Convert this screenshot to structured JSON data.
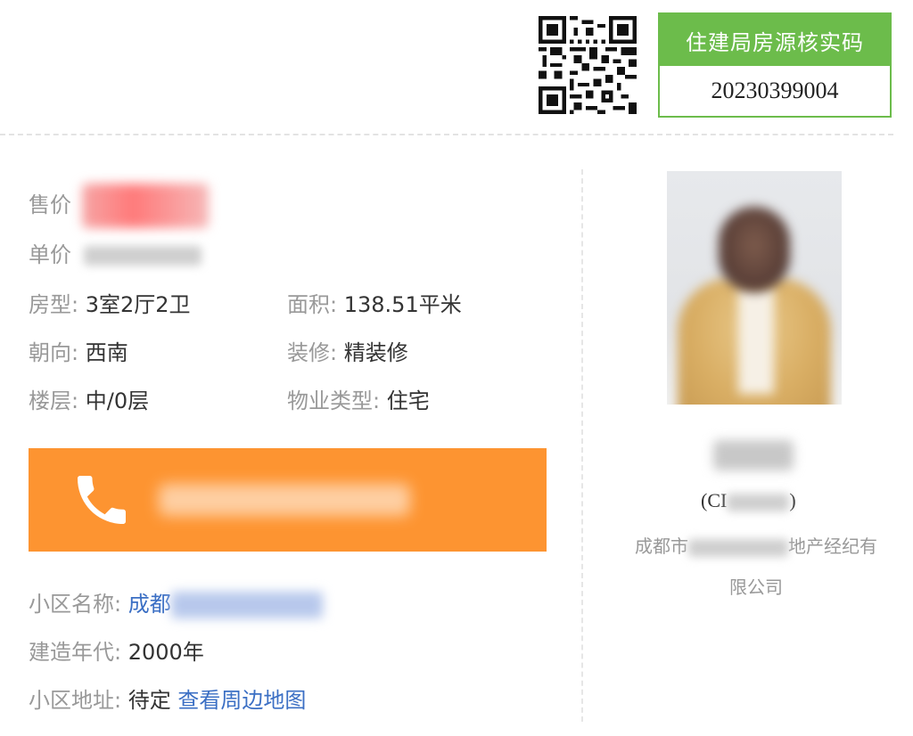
{
  "verification": {
    "title": "住建局房源核实码",
    "code": "20230399004"
  },
  "pricing": {
    "total_label": "售价",
    "unit_label": "单价"
  },
  "details": {
    "layout_label": "房型:",
    "layout_value": "3室2厅2卫",
    "area_label": "面积:",
    "area_value": "138.51平米",
    "orientation_label": "朝向:",
    "orientation_value": "西南",
    "decoration_label": "装修:",
    "decoration_value": "精装修",
    "floor_label": "楼层:",
    "floor_value": "中/0层",
    "property_type_label": "物业类型:",
    "property_type_value": "住宅"
  },
  "community": {
    "name_label": "小区名称:",
    "name_value_prefix": "成都",
    "year_label": "建造年代:",
    "year_value": "2000年",
    "address_label": "小区地址:",
    "address_value": "待定",
    "map_link": "查看周边地图"
  },
  "agent": {
    "id_prefix": "(CI",
    "id_suffix": ")",
    "company_prefix": "成都市",
    "company_suffix": "地产经纪有",
    "company_line2": "限公司"
  },
  "colors": {
    "accent_green": "#6cbc4b",
    "call_orange": "#fd9431",
    "link_blue": "#3b6fc4"
  },
  "icons": {
    "call": "phone-icon",
    "qr": "qr-code-icon"
  }
}
